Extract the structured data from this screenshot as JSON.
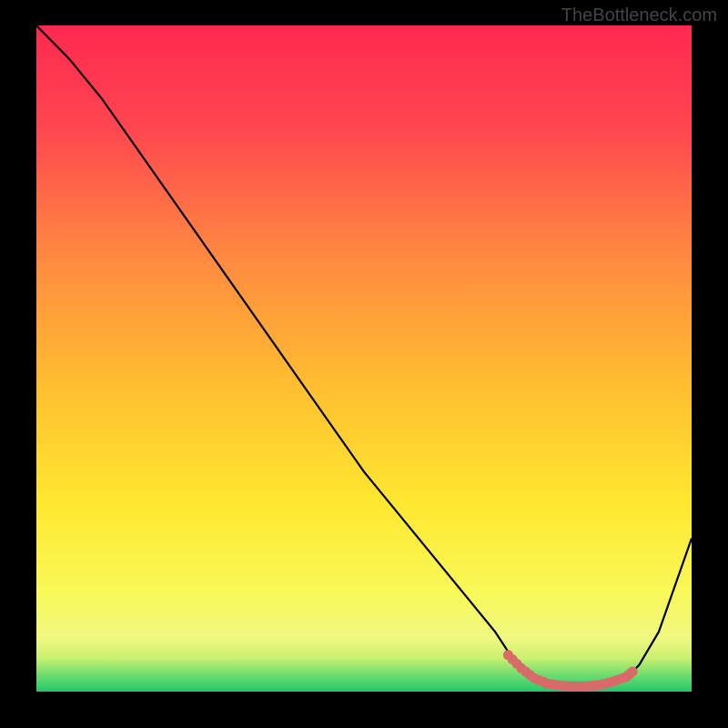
{
  "watermark": "TheBottleneck.com",
  "chart_data": {
    "type": "line",
    "title": "",
    "xlabel": "",
    "ylabel": "",
    "xlim": [
      0,
      100
    ],
    "ylim": [
      0,
      100
    ],
    "series": [
      {
        "name": "bottleneck-curve",
        "x": [
          0,
          5,
          10,
          15,
          20,
          25,
          30,
          35,
          40,
          45,
          50,
          55,
          60,
          65,
          70,
          72,
          75,
          78,
          80,
          82,
          84,
          86,
          88,
          90,
          92,
          95,
          100
        ],
        "y": [
          100,
          95,
          89,
          82,
          75,
          68,
          61,
          54,
          47,
          40,
          33,
          27,
          21,
          15,
          9,
          6,
          3,
          1.5,
          1,
          0.8,
          0.7,
          0.8,
          1.2,
          2,
          4,
          9,
          23
        ],
        "color": "#000000"
      },
      {
        "name": "highlighted-segment",
        "x": [
          72,
          74,
          76,
          78,
          80,
          82,
          84,
          86,
          88,
          90,
          91
        ],
        "y": [
          5.5,
          3.5,
          2,
          1.2,
          0.9,
          0.8,
          0.8,
          1,
          1.5,
          2.2,
          3
        ],
        "color": "#d86a6a",
        "style": "dotted-thick"
      }
    ],
    "gradient_stops": [
      {
        "offset": 0,
        "color": "#ff2850"
      },
      {
        "offset": 15,
        "color": "#ff4550"
      },
      {
        "offset": 35,
        "color": "#ff8a40"
      },
      {
        "offset": 55,
        "color": "#ffc030"
      },
      {
        "offset": 72,
        "color": "#ffe830"
      },
      {
        "offset": 85,
        "color": "#f8f858"
      },
      {
        "offset": 92,
        "color": "#f0f880"
      },
      {
        "offset": 95,
        "color": "#c8f070"
      },
      {
        "offset": 97,
        "color": "#80e070"
      },
      {
        "offset": 100,
        "color": "#20c868"
      }
    ]
  }
}
